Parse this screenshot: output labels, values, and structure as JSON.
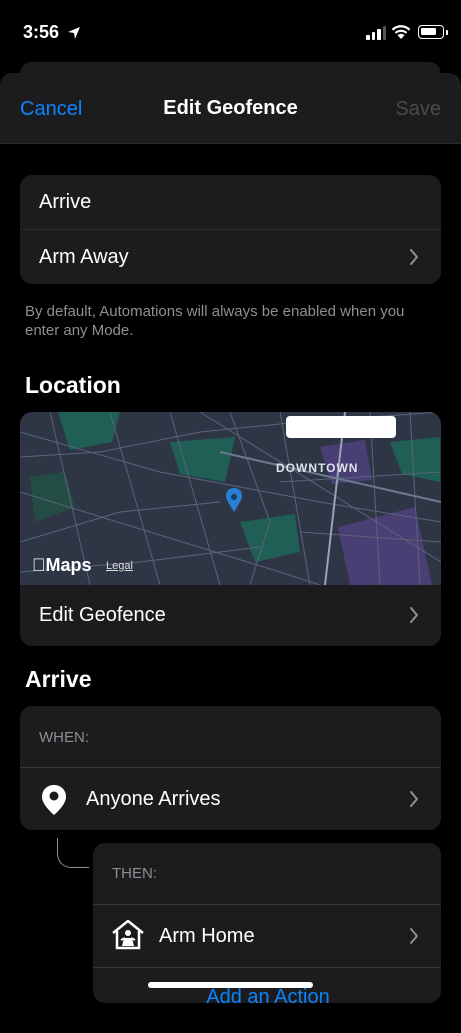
{
  "status_bar": {
    "time": "3:56",
    "location_icon": "location-arrow-icon",
    "signal_icon": "cellular-signal-icon",
    "wifi_icon": "wifi-icon",
    "battery_icon": "battery-icon"
  },
  "nav": {
    "cancel": "Cancel",
    "title": "Edit Geofence",
    "save": "Save"
  },
  "trigger": {
    "event": "Arrive",
    "mode": "Arm Away"
  },
  "footnote": "By default, Automations will always be enabled when you enter any Mode.",
  "location": {
    "section_title": "Location",
    "map": {
      "brand": "Maps",
      "legal": "Legal",
      "area_label": "DOWNTOWN",
      "pin_icon": "map-pin-icon"
    },
    "edit_label": "Edit Geofence"
  },
  "arrive": {
    "section_title": "Arrive",
    "when_label": "WHEN:",
    "when_item": "Anyone Arrives",
    "when_icon": "location-pin-icon",
    "then_label": "THEN:",
    "then_item": "Arm Home",
    "then_icon": "arm-home-icon",
    "add_action": "Add an Action"
  },
  "colors": {
    "accent": "#0a84ff",
    "card": "#1c1c1e",
    "background": "#000000",
    "secondary_text": "#8e8e93"
  }
}
